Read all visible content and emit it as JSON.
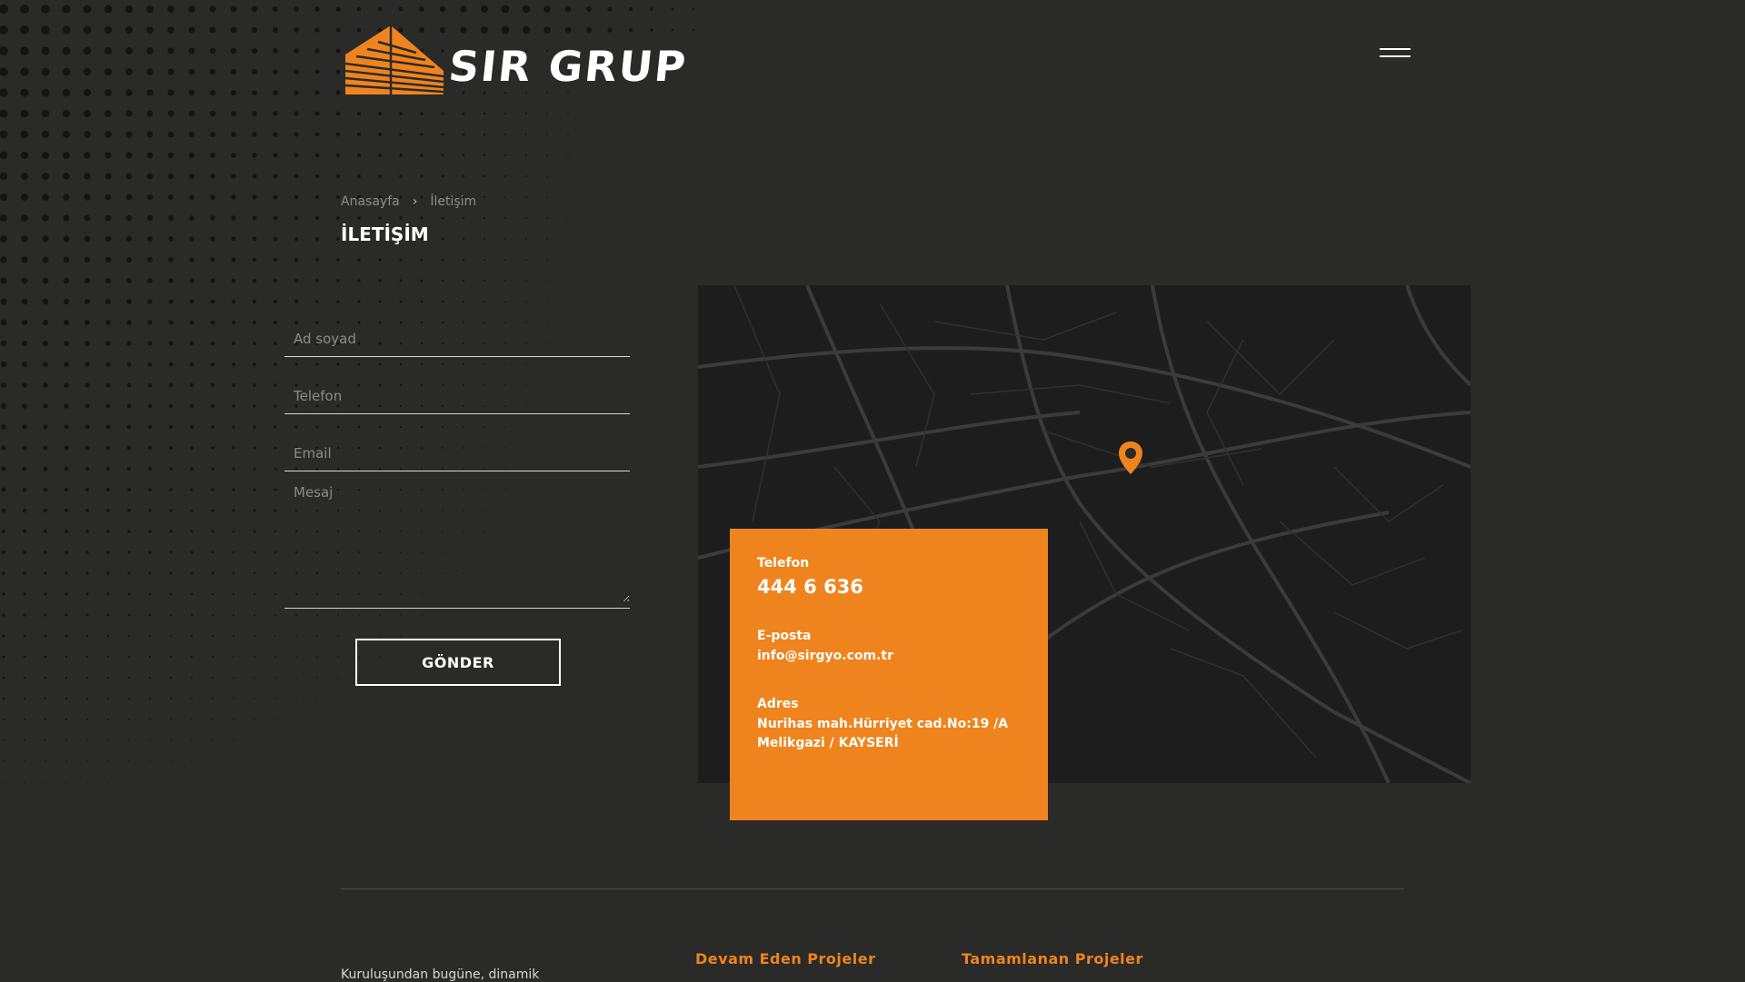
{
  "brand": {
    "name": "SIR GRUP",
    "accent": "#ef841e",
    "background": "#2a2a29"
  },
  "header": {
    "menu_icon": "hamburger-icon"
  },
  "breadcrumb": {
    "home": "Anasayfa",
    "separator": "›",
    "current": "İletişim"
  },
  "page": {
    "title": "İLETİŞİM"
  },
  "form": {
    "name_placeholder": "Ad soyad",
    "phone_placeholder": "Telefon",
    "email_placeholder": "Email",
    "message_placeholder": "Mesaj",
    "submit_label": "GÖNDER"
  },
  "contact": {
    "phone_label": "Telefon",
    "phone_value": "444 6 636",
    "email_label": "E-posta",
    "email_value": "info@sirgyo.com.tr",
    "address_label": "Adres",
    "address_line1": "Nurihas mah.Hürriyet cad.No:19 /A",
    "address_line2": "Melikgazi / KAYSERİ"
  },
  "map": {
    "marker_icon": "map-pin-icon"
  },
  "footer": {
    "about_snippet": "Kuruluşundan bugüne, dinamik",
    "col1_heading": "Devam Eden Projeler",
    "col2_heading": "Tamamlanan Projeler"
  }
}
